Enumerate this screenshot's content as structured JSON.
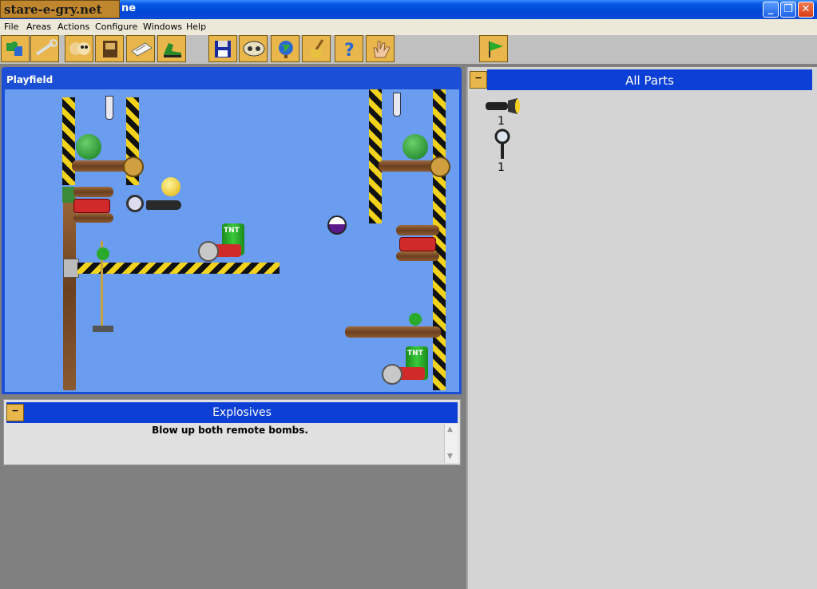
{
  "window": {
    "watermark": "stare-e-gry.net",
    "title_suffix": "ne",
    "controls": {
      "minimize": "_",
      "maximize": "❐",
      "close": "✕"
    }
  },
  "menu": [
    "File",
    "Areas",
    "Actions",
    "Configure",
    "Windows",
    "Help"
  ],
  "toolbar": {
    "buttons": [
      "puzzle-icon",
      "wrench-icon",
      "faces-icon",
      "book-icon",
      "paper-icon",
      "shoe-icon",
      "save-icon",
      "tape-icon",
      "globe-icon",
      "broom-icon",
      "help-icon",
      "hand-icon",
      "flag-icon"
    ]
  },
  "playfield": {
    "title": "Playfield",
    "bomb_labels": [
      "TNT",
      "TNT"
    ]
  },
  "goal": {
    "collapse": "−",
    "title": "Explosives",
    "text": "Blow up both remote bombs."
  },
  "parts": {
    "collapse": "−",
    "title": "All Parts",
    "items": [
      {
        "icon": "flashlight-icon",
        "count": "1"
      },
      {
        "icon": "magnifier-icon",
        "count": "1"
      }
    ]
  },
  "colors": {
    "titlebar": "#0046d5",
    "playfield_bg": "#6a9cf0",
    "toolbar_button": "#e8b64a",
    "panel": "#d4d4d4"
  }
}
